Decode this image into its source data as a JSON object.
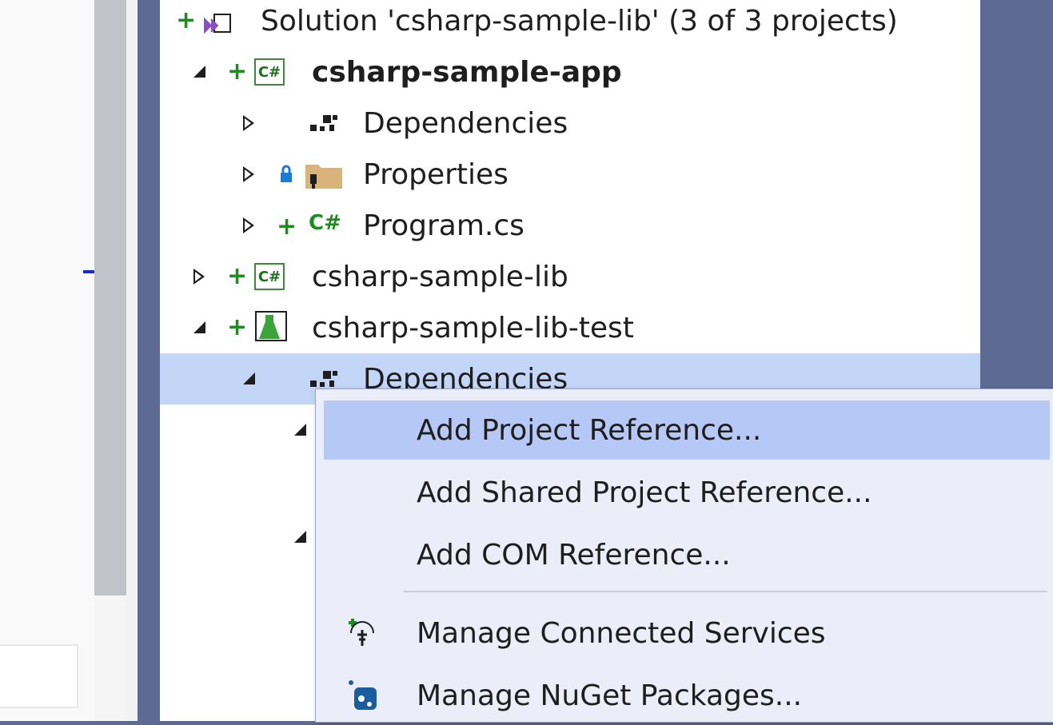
{
  "solution": {
    "label": "Solution 'csharp-sample-lib' (3 of 3 projects)"
  },
  "tree": {
    "app": {
      "label": "csharp-sample-app",
      "icon": "csharp-project-icon"
    },
    "app_dependencies": {
      "label": "Dependencies"
    },
    "app_properties": {
      "label": "Properties"
    },
    "app_program": {
      "label": "Program.cs"
    },
    "lib": {
      "label": "csharp-sample-lib"
    },
    "lib_test": {
      "label": "csharp-sample-lib-test",
      "icon": "test-project-icon"
    },
    "test_dependencies": {
      "label": "Dependencies"
    }
  },
  "context_menu": {
    "items": [
      {
        "label": "Add Project Reference...",
        "icon": ""
      },
      {
        "label": "Add Shared Project Reference...",
        "icon": ""
      },
      {
        "label": "Add COM Reference...",
        "icon": ""
      },
      {
        "label": "Manage Connected Services",
        "icon": "connected-services-icon"
      },
      {
        "label": "Manage NuGet Packages...",
        "icon": "nuget-icon"
      }
    ]
  },
  "colors": {
    "accent_selection": "#c4d6f7",
    "menu_highlight": "#b6c8f5",
    "chrome": "#5c6a94",
    "source_control_added": "#1e8c1e"
  }
}
